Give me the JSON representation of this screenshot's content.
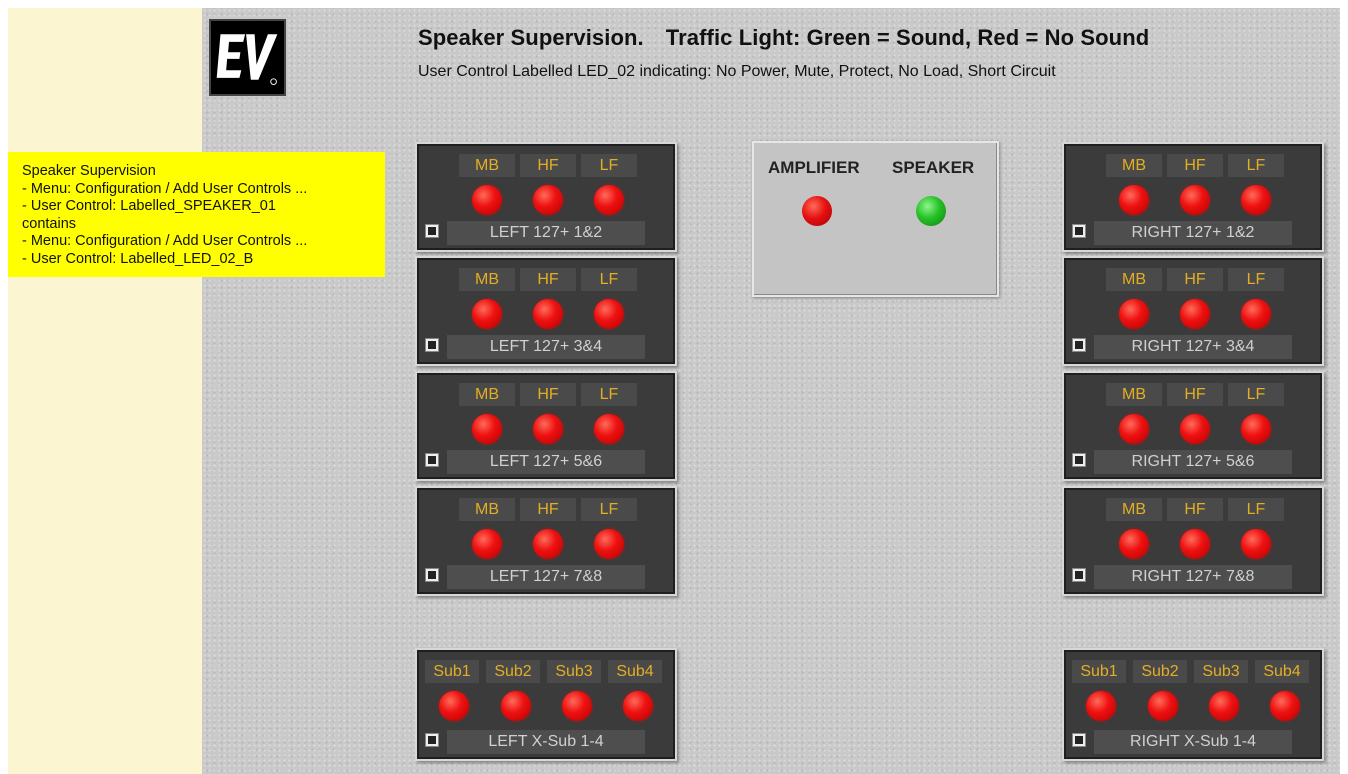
{
  "header": {
    "title": "Speaker Supervision.",
    "legend": "Traffic Light: Green = Sound, Red = No Sound",
    "subtitle": "User Control Labelled LED_02 indicating: No Power, Mute, Protect, No Load, Short Circuit"
  },
  "logo": {
    "text": "EV"
  },
  "note": {
    "lines": [
      "Speaker Supervision",
      "- Menu: Configuration / Add User Controls ...",
      "- User Control: Labelled_SPEAKER_01",
      "contains",
      "- Menu: Configuration / Add User Controls ...",
      "- User Control: Labelled_LED_02_B"
    ]
  },
  "status": {
    "amplifier_label": "AMPLIFIER",
    "speaker_label": "SPEAKER",
    "amplifier_color": "#e51111",
    "speaker_color": "#26c226"
  },
  "band_labels": [
    "MB",
    "HF",
    "LF"
  ],
  "sub_labels": [
    "Sub1",
    "Sub2",
    "Sub3",
    "Sub4"
  ],
  "left_panels": [
    {
      "name": "LEFT 127+  1&2"
    },
    {
      "name": "LEFT 127+  3&4"
    },
    {
      "name": "LEFT 127+  5&6"
    },
    {
      "name": "LEFT 127+  7&8"
    }
  ],
  "right_panels": [
    {
      "name": "RIGHT 127+  1&2"
    },
    {
      "name": "RIGHT 127+  3&4"
    },
    {
      "name": "RIGHT 127+  5&6"
    },
    {
      "name": "RIGHT 127+  7&8"
    }
  ],
  "left_sub": {
    "name": "LEFT X-Sub 1-4"
  },
  "right_sub": {
    "name": "RIGHT X-Sub 1-4"
  },
  "led_color": "#ee1111"
}
